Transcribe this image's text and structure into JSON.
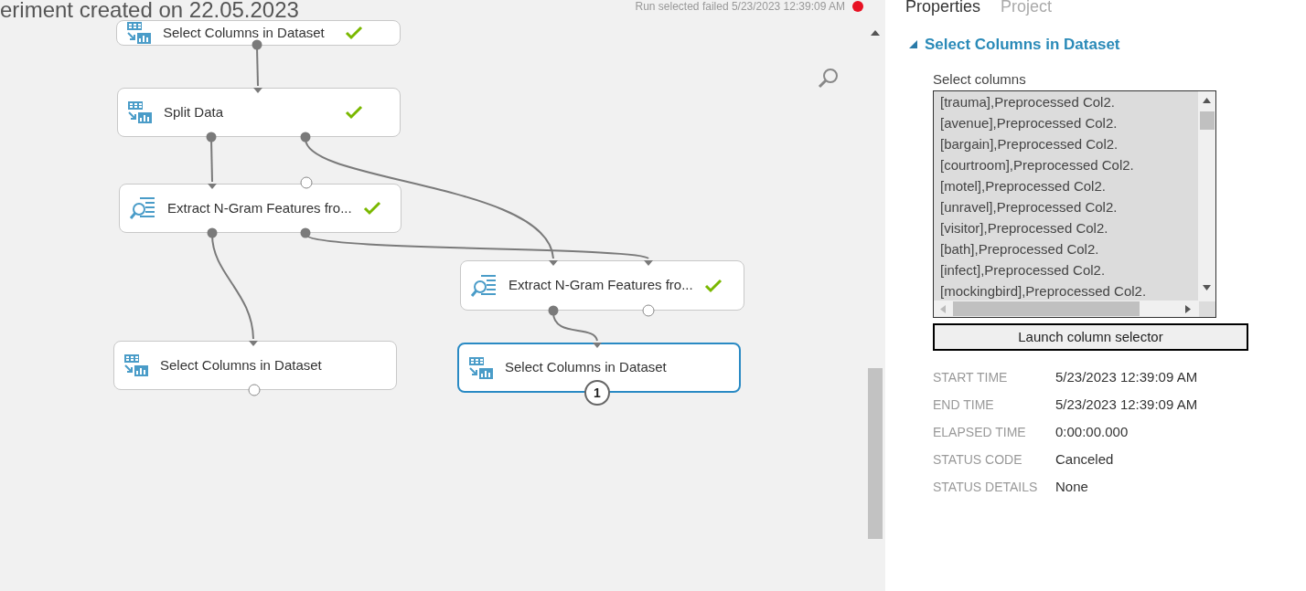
{
  "header": {
    "title": "eriment created on 22.05.2023",
    "run_status": "Run selected failed 5/23/2023 12:39:09 AM"
  },
  "canvas": {
    "nodes": [
      {
        "label": "Select Columns in Dataset",
        "kind": "select",
        "done": true,
        "selected": false
      },
      {
        "label": "Split Data",
        "kind": "select",
        "done": true,
        "selected": false
      },
      {
        "label": "Extract N-Gram Features fro...",
        "kind": "ngram",
        "done": true,
        "selected": false
      },
      {
        "label": "Extract N-Gram Features fro...",
        "kind": "ngram",
        "done": true,
        "selected": false
      },
      {
        "label": "Select Columns in Dataset",
        "kind": "select",
        "done": false,
        "selected": false
      },
      {
        "label": "Select Columns in Dataset",
        "kind": "select",
        "done": false,
        "selected": true,
        "badge": "1"
      }
    ]
  },
  "panel": {
    "tabs": [
      {
        "label": "Properties",
        "selected": true
      },
      {
        "label": "Project",
        "selected": false
      }
    ],
    "section": {
      "title": "Select Columns in Dataset",
      "expanded": true,
      "field_label": "Select columns",
      "columns": [
        "[trauma],Preprocessed Col2.",
        "[avenue],Preprocessed Col2.",
        "[bargain],Preprocessed Col2.",
        "[courtroom],Preprocessed Col2.",
        "[motel],Preprocessed Col2.",
        "[unravel],Preprocessed Col2.",
        "[visitor],Preprocessed Col2.",
        "[bath],Preprocessed Col2.",
        "[infect],Preprocessed Col2.",
        "[mockingbird],Preprocessed Col2."
      ],
      "button": "Launch column selector"
    },
    "details": [
      {
        "label": "START TIME",
        "value": "5/23/2023 12:39:09 AM"
      },
      {
        "label": "END TIME",
        "value": "5/23/2023 12:39:09 AM"
      },
      {
        "label": "ELAPSED TIME",
        "value": "0:00:00.000"
      },
      {
        "label": "STATUS CODE",
        "value": "Canceled"
      },
      {
        "label": "STATUS DETAILS",
        "value": "None"
      }
    ]
  }
}
